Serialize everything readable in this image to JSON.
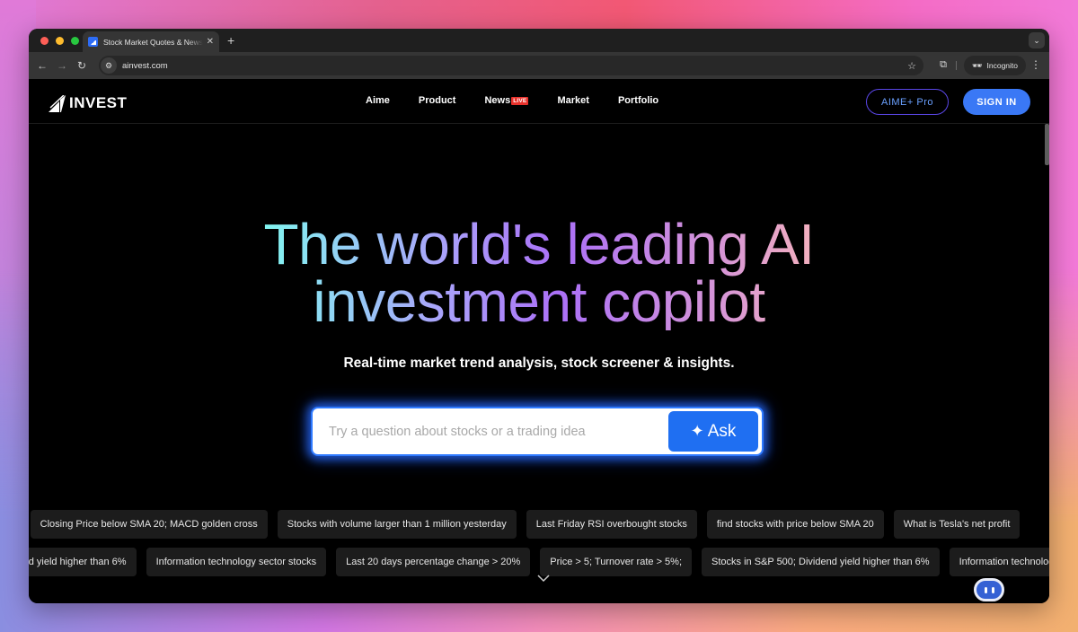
{
  "browser": {
    "tab_title": "Stock Market Quotes & News",
    "url": "ainvest.com",
    "incognito_label": "Incognito"
  },
  "header": {
    "logo_text": "INVEST",
    "nav": [
      {
        "label": "Aime"
      },
      {
        "label": "Product"
      },
      {
        "label": "News",
        "badge": "LIVE"
      },
      {
        "label": "Market"
      },
      {
        "label": "Portfolio"
      }
    ],
    "pro_button": "AIME+ Pro",
    "signin_button": "SIGN IN"
  },
  "hero": {
    "title_line1": "The world's leading AI",
    "title_line2": "investment copilot",
    "subtitle": "Real-time market trend analysis, stock screener & insights.",
    "search_placeholder": "Try a question about stocks or a trading idea",
    "ask_button": "Ask"
  },
  "suggestions": {
    "row1": [
      "What is Tesla's net profit",
      "Closing Price below SMA 20; MACD golden cross",
      "Stocks with volume larger than 1 million yesterday",
      "Last Friday RSI overbought stocks",
      "find stocks with price below SMA 20",
      "What is Tesla's net profit"
    ],
    "row2": [
      "Stocks in S&P 500; Dividend yield higher than 6%",
      "Information technology sector stocks",
      "Last 20 days percentage change > 20%",
      "Price > 5; Turnover rate > 5%;",
      "Stocks in S&P 500; Dividend yield higher than 6%",
      "Information technology sector stocks"
    ]
  },
  "colors": {
    "accent_blue": "#1f6ff2",
    "signin_blue": "#3a78f5",
    "live_red": "#e8322c"
  }
}
